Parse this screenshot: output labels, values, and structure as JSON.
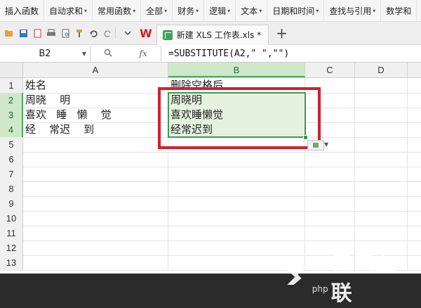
{
  "ribbon": {
    "items": [
      {
        "label": "插入函数",
        "caret": false
      },
      {
        "label": "自动求和",
        "caret": true
      },
      {
        "label": "常用函数",
        "caret": true
      },
      {
        "label": "全部",
        "caret": true
      },
      {
        "label": "财务",
        "caret": true
      },
      {
        "label": "逻辑",
        "caret": true
      },
      {
        "label": "文本",
        "caret": true
      },
      {
        "label": "日期和时间",
        "caret": true
      },
      {
        "label": "查找与引用",
        "caret": true
      },
      {
        "label": "数学和",
        "caret": false
      }
    ]
  },
  "toolbar": {
    "logo": "W",
    "doc_tab_label": "新建 XLS 工作表.xls *",
    "new_tab": "+"
  },
  "formula_bar": {
    "name_box": "B2",
    "fx": "fx",
    "formula": "=SUBSTITUTE(A2,\" \",\"\")"
  },
  "sheet": {
    "columns": [
      "A",
      "B",
      "C",
      "D"
    ],
    "rows": [
      "1",
      "2",
      "3",
      "4",
      "5",
      "6",
      "7",
      "8",
      "9",
      "10",
      "11",
      "12",
      "13"
    ],
    "cells": {
      "A1": "姓名",
      "B1": "删除空格后",
      "A2": "周晓    明",
      "B2": "周晓明",
      "A3": "喜欢   睡   懒    觉",
      "B3": "喜欢睡懒觉",
      "A4": "经    常迟    到",
      "B4": "经常迟到"
    },
    "active_column": "B",
    "active_rows": [
      "2",
      "3",
      "4"
    ]
  },
  "watermark": {
    "text": "自由互联",
    "sub": "php"
  },
  "colors": {
    "selection": "#3e9a4f",
    "highlight_box": "#d2202e",
    "wps_red": "#d71921"
  }
}
